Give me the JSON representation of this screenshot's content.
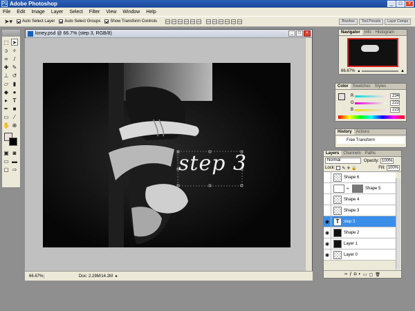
{
  "app": {
    "title": "Adobe Photoshop"
  },
  "menu": [
    "File",
    "Edit",
    "Image",
    "Layer",
    "Select",
    "Filter",
    "View",
    "Window",
    "Help"
  ],
  "options": {
    "auto_select_layer": "Auto Select Layer",
    "auto_select_groups": "Auto Select Groups",
    "show_transform_controls": "Show Transform Controls",
    "wells": [
      "Brushes",
      "Tool Presets",
      "Layer Comps"
    ]
  },
  "document": {
    "title": "loney.psd @ 66.7% (step 3, RGB/8)",
    "zoom": "66.67%",
    "doc_size": "Doc: 2.29M/14.2M",
    "canvas_text": "step 3"
  },
  "navigator": {
    "tabs": [
      "Navigator",
      "Info",
      "Histogram"
    ],
    "zoom": "66.67%"
  },
  "color_panel": {
    "tabs": [
      "Color",
      "Swatches",
      "Styles"
    ],
    "r_label": "R",
    "r_value": "234",
    "g_label": "G",
    "g_value": "222",
    "b_label": "B",
    "b_value": "223"
  },
  "history_panel": {
    "tabs": [
      "History",
      "Actions"
    ],
    "item": "Free Transform"
  },
  "layers_panel": {
    "tabs": [
      "Layers",
      "Channels",
      "Paths"
    ],
    "blend_mode": "Normal",
    "opacity_label": "Opacity:",
    "opacity_value": "100%",
    "lock_label": "Lock:",
    "fill_label": "Fill:",
    "fill_value": "100%",
    "layers": [
      {
        "name": "Shape 6",
        "visible": false,
        "thumb": "check"
      },
      {
        "name": "Shape 5",
        "visible": false,
        "thumb": "white"
      },
      {
        "name": "Shape 4",
        "visible": false,
        "thumb": "check"
      },
      {
        "name": "Shape 3",
        "visible": false,
        "thumb": "check"
      },
      {
        "name": "step 3",
        "visible": true,
        "thumb": "text",
        "selected": true
      },
      {
        "name": "Shape 2",
        "visible": true,
        "thumb": "dark"
      },
      {
        "name": "Layer 1",
        "visible": true,
        "thumb": "dark"
      },
      {
        "name": "Layer 0",
        "visible": true,
        "thumb": "check"
      }
    ],
    "text_thumb_glyph": "T"
  }
}
